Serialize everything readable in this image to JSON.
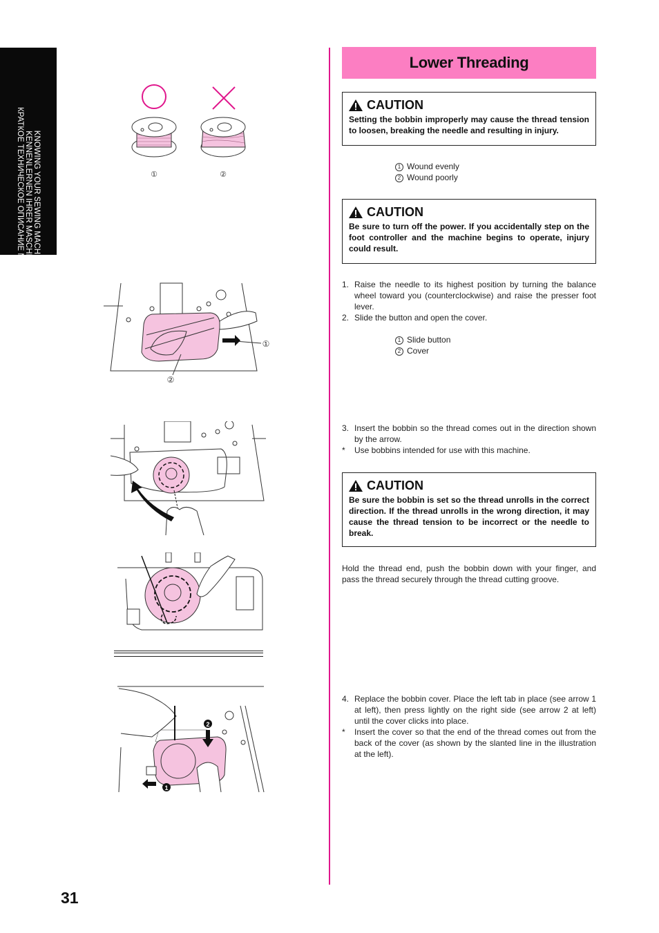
{
  "sidebar": {
    "lines": [
      "KNOWING YOUR SEWING MACHINE",
      "KENNENLERNEN IHRER MASCHINE",
      "КРАТКОЕ ТЕХНИЧЕСКОЕ ОПИСАНИЕ МАШИНЫ"
    ]
  },
  "header": {
    "title": "Lower Threading"
  },
  "colors": {
    "accent": "#e0168c",
    "title_bg": "#fc7ec2",
    "illustration_pink": "#f5c3df"
  },
  "cautions": [
    {
      "label": "CAUTION",
      "icon": "warning-triangle-icon",
      "text": "Setting the bobbin improperly may cause the thread tension to loosen, breaking the needle and resulting in injury."
    },
    {
      "label": "CAUTION",
      "icon": "warning-triangle-icon",
      "text": "Be sure to turn off the power. If you accidentally step on the foot controller and the machine begins to operate, injury could result."
    },
    {
      "label": "CAUTION",
      "icon": "warning-triangle-icon",
      "text": "Be sure the bobbin is set so the thread unrolls in the correct direction. If the thread unrolls in the wrong direction, it may cause the thread tension to be incorrect or the needle to break."
    }
  ],
  "bobbin_legend": [
    {
      "num": "1",
      "label": "Wound evenly"
    },
    {
      "num": "2",
      "label": "Wound poorly"
    }
  ],
  "cover_legend": [
    {
      "num": "1",
      "label": "Slide button"
    },
    {
      "num": "2",
      "label": "Cover"
    }
  ],
  "steps": {
    "s1": {
      "num": "1.",
      "text": "Raise the needle to its highest position by turning the balance wheel toward you (counterclockwise) and raise the presser foot lever."
    },
    "s2": {
      "num": "2.",
      "text": "Slide the button and open the cover."
    },
    "s3": {
      "num": "3.",
      "text": "Insert the bobbin so the thread comes out in the direction shown by the arrow."
    },
    "s3_note": {
      "num": "*",
      "text": "Use bobbins intended for use with this machine."
    },
    "hold": "Hold the thread end, push the bobbin down with your finger, and pass the thread securely through the thread cutting groove.",
    "s4": {
      "num": "4.",
      "text": "Replace the bobbin cover. Place the left tab in place (see arrow 1 at left), then press lightly on the right side (see arrow 2 at left) until the cover clicks into place."
    },
    "s4_note": {
      "num": "*",
      "text": "Insert the cover so that the end of the thread comes out from the back of the cover (as shown by the slanted line in the illustration at the left)."
    }
  },
  "illustration_labels": {
    "bobbin_ok_mark": "○",
    "bobbin_bad_mark": "×",
    "callout_1": "1",
    "callout_2": "2",
    "arrow_1": "1",
    "arrow_2": "2"
  },
  "page_number": "31"
}
